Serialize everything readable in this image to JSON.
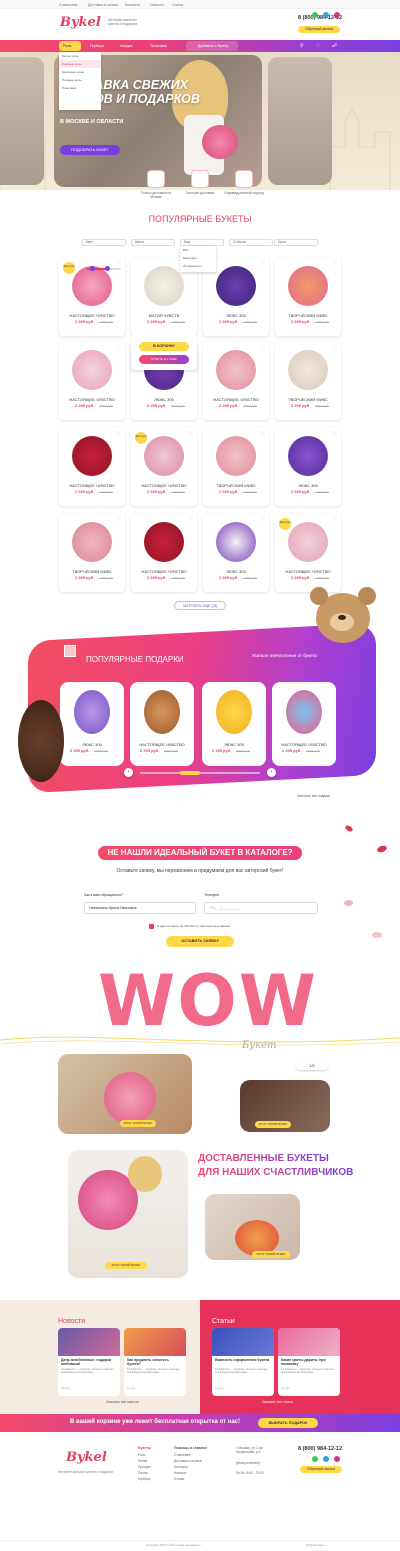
{
  "topbar": {
    "links": [
      "О магазине",
      "Доставка и оплата",
      "Контакты",
      "Новости",
      "Статьи"
    ]
  },
  "header": {
    "logo": "Bykel",
    "tagline": "Интернет-магазин цветов и подарков",
    "phone": "8 (800) 984-12-12",
    "callback": "Обратный звонок"
  },
  "nav": {
    "items": [
      "Розы",
      "Гербера",
      "Ниндзя",
      "Тюльпаны"
    ],
    "gift_label": "Добавить к букету",
    "dropdown": [
      "Белые розы",
      "Красные розы",
      "Кремовые розы",
      "Розовые розы",
      "Розы микс"
    ]
  },
  "hero": {
    "title_line1": "ДОСТАВКА СВЕЖИХ",
    "title_line2": "ЦВЕТОВ И ПОДАРКОВ",
    "subtitle": "В МОСКВЕ И ОБЛАСТИ",
    "button": "ПОДОБРАТЬ БУКЕТ"
  },
  "features": [
    "Только доставка по Москве",
    "Быстрая доставка",
    "Индивидуальный подход"
  ],
  "popular": {
    "title": "ПОПУЛЯРНЫЕ БУКЕТЫ",
    "filters": [
      "Цвет",
      "Цвета",
      "Вид",
      "Событие",
      "Цена"
    ],
    "filter_dropdown": [
      "Все",
      "Монстера",
      "Ингредиенты"
    ]
  },
  "products": [
    {
      "name": "НАСТОЯЩЕЕ ЧУВСТВО",
      "price": "2 295 руб.",
      "old": "2 500 руб.",
      "badge": "Букет дня"
    },
    {
      "name": "МАГИЯ ЧУВСТВ",
      "price": "2 295 руб.",
      "old": "2 500 руб.",
      "badge": ""
    },
    {
      "name": "ЛЮКС 300",
      "price": "2 295 руб.",
      "old": "2 500 руб.",
      "badge": ""
    },
    {
      "name": "ТВОРЧЕСКИЙ МИКС",
      "price": "2 295 руб.",
      "old": "2 500 руб.",
      "badge": ""
    },
    {
      "name": "НАСТОЯЩЕЕ ЧУВСТВО",
      "price": "2 295 руб.",
      "old": "2 500 руб.",
      "badge": ""
    },
    {
      "name": "ЛЮКС 300",
      "price": "2 295 руб.",
      "old": "2 500 руб.",
      "badge": ""
    },
    {
      "name": "НАСТОЯЩЕЕ ЧУВСТВО",
      "price": "2 295 руб.",
      "old": "2 500 руб.",
      "badge": ""
    },
    {
      "name": "ТВОРЧЕСКИЙ МИКС",
      "price": "2 295 руб.",
      "old": "2 500 руб.",
      "badge": ""
    },
    {
      "name": "НАСТОЯЩЕЕ ЧУВСТВО",
      "price": "2 295 руб.",
      "old": "2 500 руб.",
      "badge": ""
    },
    {
      "name": "НАСТОЯЩЕЕ ЧУВСТВО",
      "price": "2 295 руб.",
      "old": "2 500 руб.",
      "badge": "Букет дня"
    },
    {
      "name": "ТВОРЧЕСКИЙ МИКС",
      "price": "2 295 руб.",
      "old": "2 500 руб.",
      "badge": ""
    },
    {
      "name": "ЛЮКС 300",
      "price": "2 295 руб.",
      "old": "2 500 руб.",
      "badge": ""
    },
    {
      "name": "ТВОРЧЕСКИЙ МИКС",
      "price": "2 295 руб.",
      "old": "2 500 руб.",
      "badge": ""
    },
    {
      "name": "НАСТОЯЩЕЕ ЧУВСТВО",
      "price": "2 295 руб.",
      "old": "2 500 руб.",
      "badge": ""
    },
    {
      "name": "ЛЮКС 300",
      "price": "2 295 руб.",
      "old": "2 500 руб.",
      "badge": ""
    },
    {
      "name": "НАСТОЯЩЕЕ ЧУВСТВО",
      "price": "2 295 руб.",
      "old": "2 500 руб.",
      "badge": "Букет дня"
    }
  ],
  "hover": {
    "cart": "В КОРЗИНУ",
    "quick": "КУПИТЬ В 1 КЛИК"
  },
  "load_more": "ЗАГРУЗИТЬ ЕЩЁ (15)",
  "gifts": {
    "title": "ПОПУЛЯРНЫЕ ПОДАРКИ",
    "subtitle": "Усильте впечатление от букета",
    "all": "Смотреть все подарки",
    "items": [
      {
        "name": "ЛЮКС 300",
        "price": "2 295 руб.",
        "old": "2 500 руб."
      },
      {
        "name": "НАСТОЯЩЕЕ ЧУВСТВО",
        "price": "2 295 руб.",
        "old": "2 500 руб."
      },
      {
        "name": "ЛЮКС 300",
        "price": "2 295 руб.",
        "old": "2 500 руб."
      },
      {
        "name": "НАСТОЯЩЕЕ ЧУВСТВО",
        "price": "2 295 руб.",
        "old": "2 500 руб."
      }
    ]
  },
  "form": {
    "title": "НЕ НАШЛИ ИДЕАЛЬНЫЙ БУКЕТ В КАТАЛОГЕ?",
    "subtitle": "Оставьте заявку, мы перезвоним и придумаем для вас авторский букет!",
    "name_label": "Как к вам обращаться?",
    "name_value": "Наташкина Ирина Ивановна",
    "phone_label": "Телефон",
    "phone_placeholder": "+7 (___) ___-__-__",
    "consent": "Я даю согласие на обработку персональных данных",
    "submit": "ОСТАВИТЬ ЗАЯВКУ"
  },
  "wow": {
    "word": "WOW",
    "script": "Букет",
    "counter": "1/5",
    "btn": "ХОЧУ ТАКОЙ БУКЕТ"
  },
  "delivered": {
    "title_line1": "ДОСТАВЛЕННЫЕ БУКЕТЫ",
    "title_line2": "ДЛЯ НАШИХ СЧАСТЛИВЧИКОВ",
    "btn": "ХОЧУ ТАКОЙ БУКЕТ"
  },
  "news": {
    "title": "Новости",
    "all": "Смотреть все новости",
    "items": [
      {
        "t": "День влюбленных: подарки любимым!",
        "d": "14 февраля — праздник, который отмечают влюбленные во всем мире",
        "date": "23 мая"
      },
      {
        "t": "Как продлить свежесть букета?",
        "d": "14 февраля — праздник, который отмечают влюбленные во всем мире",
        "date": "23 мая"
      }
    ]
  },
  "articles": {
    "title": "Статьи",
    "all": "Смотреть все статьи",
    "items": [
      {
        "t": "Важность оформления букета",
        "d": "14 февраля — праздник, который отмечают влюбленные во всем мире",
        "date": "23 мая"
      },
      {
        "t": "Какие цветы дарить: про помолвку",
        "d": "14 февраля — праздник, который отмечают влюбленные во всем мире",
        "date": "23 мая"
      }
    ]
  },
  "cart": {
    "text": "В вашей корзине уже лежит бесплатная открытка от нас!",
    "btn": "ВЫБРАТЬ ПОДАРОК"
  },
  "footer": {
    "tagline": "Интернет-магазин цветов и подарков",
    "col1_head": "Букеты",
    "col1": [
      "Розы",
      "Лилии",
      "Орхидеи",
      "Пионы",
      "Гербера"
    ],
    "col2_head": "Помощь и главное",
    "col2": [
      "О магазине",
      "Доставка и оплата",
      "Контакты",
      "Новости",
      "Статьи"
    ],
    "address": "г. Москва, ул. 2-ая Продольная, д.2",
    "email": "[email protected]",
    "hours": "Пн-Вс: 8:00 - 23:00",
    "phone": "8 (800) 984-12-12",
    "callback": "Обратный звонок",
    "copyright": "Copyright 2018 © Все права защищены",
    "dev": "Разработано —"
  },
  "colors": {
    "accent": "#e2405e",
    "purple": "#7b3fe0",
    "yellow": "#ffd84a"
  }
}
